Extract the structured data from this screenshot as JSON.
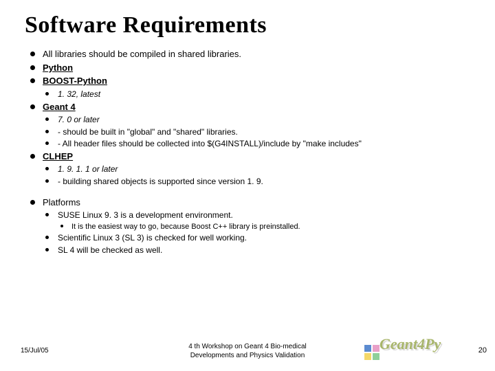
{
  "title": "Software Requirements",
  "items": {
    "i0": "All libraries should be compiled in shared libraries.",
    "i1": "Python",
    "i2": "BOOST-Python",
    "i2s0": "1. 32, latest",
    "i3": "Geant 4",
    "i3s0": "7. 0 or later",
    "i3s1": "- should be built in \"global\" and \"shared\" libraries.",
    "i3s2": "- All header files should be collected into $(G4INSTALL)/include by \"make includes\"",
    "i4": "CLHEP",
    "i4s0": "1. 9. 1. 1 or later",
    "i4s1": "- building shared objects is supported since version 1. 9.",
    "i5": "Platforms",
    "i5s0": "SUSE Linux 9. 3 is a development environment.",
    "i5s0s0": "It is the easiest way to go, because Boost C++ library is preinstalled.",
    "i5s1": "Scientific Linux 3 (SL 3) is checked for well working.",
    "i5s2": "SL 4 will be checked as well."
  },
  "footer": {
    "date": "15/Jul/05",
    "venue_line1": "4 th Workshop on Geant 4 Bio-medical",
    "venue_line2": "Developments and Physics Validation",
    "page": "20",
    "logo_text": "Geant4Py"
  }
}
